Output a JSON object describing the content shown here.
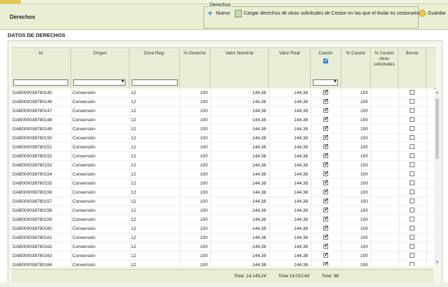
{
  "header": {
    "title": "Derechos",
    "fieldset_legend": "Derechos",
    "nuevo_label": "Nuevo",
    "cargar_label": "Cargar derechos de otras solicitudes de Cesion en las que el titular es cesionario",
    "guardar_label": "Guardar"
  },
  "section_title": "DATOS DE DERECHOS",
  "columns": [
    "Id",
    "Origen",
    "Zona Reg.",
    "% Derecho",
    "Valor Nominal",
    "Valor Real",
    "Casión",
    "% Casión",
    "% Cesion otras solicitudes",
    "Borrar"
  ],
  "rows": [
    {
      "id": "DAB000038780145",
      "origen": "Conversión",
      "zona": "12",
      "derecho": "100",
      "nominal": "144,38",
      "real": "144,38",
      "cesion": true,
      "pct": "100",
      "borrar": false
    },
    {
      "id": "DAB000038780146",
      "origen": "Conversión",
      "zona": "12",
      "derecho": "100",
      "nominal": "144,38",
      "real": "144,38",
      "cesion": true,
      "pct": "100",
      "borrar": false
    },
    {
      "id": "DAB000038780147",
      "origen": "Conversión",
      "zona": "12",
      "derecho": "100",
      "nominal": "144,38",
      "real": "144,38",
      "cesion": true,
      "pct": "100",
      "borrar": false
    },
    {
      "id": "DAB000038780148",
      "origen": "Conversión",
      "zona": "12",
      "derecho": "100",
      "nominal": "144,38",
      "real": "144,38",
      "cesion": true,
      "pct": "100",
      "borrar": false
    },
    {
      "id": "DAB000038780149",
      "origen": "Conversión",
      "zona": "12",
      "derecho": "100",
      "nominal": "144,38",
      "real": "144,38",
      "cesion": true,
      "pct": "100",
      "borrar": false
    },
    {
      "id": "DAB000038780150",
      "origen": "Conversión",
      "zona": "12",
      "derecho": "100",
      "nominal": "144,38",
      "real": "144,38",
      "cesion": true,
      "pct": "100",
      "borrar": false
    },
    {
      "id": "DAB000038780151",
      "origen": "Conversión",
      "zona": "12",
      "derecho": "100",
      "nominal": "144,38",
      "real": "144,38",
      "cesion": true,
      "pct": "100",
      "borrar": false
    },
    {
      "id": "DAB000038780152",
      "origen": "Conversión",
      "zona": "12",
      "derecho": "100",
      "nominal": "144,38",
      "real": "144,38",
      "cesion": true,
      "pct": "100",
      "borrar": false
    },
    {
      "id": "DAB000038780153",
      "origen": "Conversión",
      "zona": "12",
      "derecho": "100",
      "nominal": "144,38",
      "real": "144,38",
      "cesion": true,
      "pct": "100",
      "borrar": false
    },
    {
      "id": "DAB000038780154",
      "origen": "Conversión",
      "zona": "12",
      "derecho": "100",
      "nominal": "144,38",
      "real": "144,38",
      "cesion": true,
      "pct": "100",
      "borrar": false
    },
    {
      "id": "DAB000038780155",
      "origen": "Conversión",
      "zona": "12",
      "derecho": "100",
      "nominal": "144,38",
      "real": "144,38",
      "cesion": true,
      "pct": "100",
      "borrar": false
    },
    {
      "id": "DAB000038780156",
      "origen": "Conversión",
      "zona": "12",
      "derecho": "100",
      "nominal": "144,38",
      "real": "144,38",
      "cesion": true,
      "pct": "100",
      "borrar": false
    },
    {
      "id": "DAB000038780157",
      "origen": "Conversión",
      "zona": "12",
      "derecho": "100",
      "nominal": "144,38",
      "real": "144,38",
      "cesion": true,
      "pct": "100",
      "borrar": false
    },
    {
      "id": "DAB000038780158",
      "origen": "Conversión",
      "zona": "12",
      "derecho": "100",
      "nominal": "144,38",
      "real": "144,38",
      "cesion": true,
      "pct": "100",
      "borrar": false
    },
    {
      "id": "DAB000038780159",
      "origen": "Conversión",
      "zona": "12",
      "derecho": "100",
      "nominal": "144,38",
      "real": "144,38",
      "cesion": true,
      "pct": "100",
      "borrar": false
    },
    {
      "id": "DAB000038780160",
      "origen": "Conversión",
      "zona": "12",
      "derecho": "100",
      "nominal": "144,38",
      "real": "144,38",
      "cesion": true,
      "pct": "100",
      "borrar": false
    },
    {
      "id": "DAB000038780161",
      "origen": "Conversión",
      "zona": "12",
      "derecho": "100",
      "nominal": "144,38",
      "real": "144,38",
      "cesion": true,
      "pct": "100",
      "borrar": false
    },
    {
      "id": "DAB000038780162",
      "origen": "Conversión",
      "zona": "12",
      "derecho": "100",
      "nominal": "144,38",
      "real": "144,38",
      "cesion": true,
      "pct": "100",
      "borrar": false
    },
    {
      "id": "DAB000038780163",
      "origen": "Conversión",
      "zona": "12",
      "derecho": "100",
      "nominal": "144,38",
      "real": "144,38",
      "cesion": true,
      "pct": "100",
      "borrar": false
    },
    {
      "id": "DAB000038780164",
      "origen": "Conversión",
      "zona": "12",
      "derecho": "100",
      "nominal": "144,38",
      "real": "144,38",
      "cesion": true,
      "pct": "100",
      "borrar": false
    },
    {
      "id": "DAB000038780165",
      "origen": "Conversión",
      "zona": "12",
      "derecho": "100",
      "nominal": "144,38",
      "real": "144,38",
      "cesion": true,
      "pct": "100",
      "borrar": false
    },
    {
      "id": "DAB000038780166",
      "origen": "Conversión",
      "zona": "12",
      "derecho": "100",
      "nominal": "144,38",
      "real": "144,38",
      "cesion": true,
      "pct": "100",
      "borrar": false
    }
  ],
  "footer": {
    "total_nominal": "Total: 14.149,24",
    "total_real": "Total 14.010,64",
    "total_pct": "Total: 98"
  },
  "colors": {
    "header_bg": "#e8efd4",
    "border": "#c5cdb0",
    "accent_check": "#2f7fdd"
  }
}
